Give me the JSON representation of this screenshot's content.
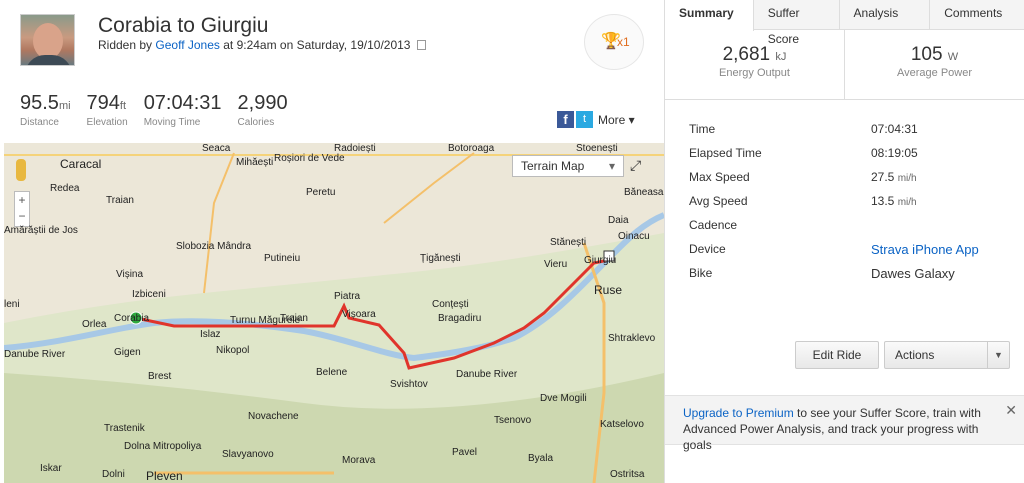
{
  "activity": {
    "title": "Corabia to Giurgiu",
    "ridden_by_prefix": "Ridden by",
    "athlete": "Geoff Jones",
    "time_text": "at 9:24am on Saturday, 19/10/2013",
    "achievement_count": "x1"
  },
  "stats": [
    {
      "value": "95.5",
      "unit": "mi",
      "label": "Distance"
    },
    {
      "value": "794",
      "unit": "ft",
      "label": "Elevation"
    },
    {
      "value": "07:04:31",
      "unit": "",
      "label": "Moving Time"
    },
    {
      "value": "2,990",
      "unit": "",
      "label": "Calories"
    }
  ],
  "share": {
    "facebook": "f",
    "twitter": "t",
    "more_label": "More ▾"
  },
  "map": {
    "type_label": "Terrain Map",
    "zoom_in": "+",
    "zoom_out": "−",
    "labels": [
      "Caracal",
      "Seaca",
      "Mihăești",
      "Roșiori de Vede",
      "Radoiești",
      "Botoroaga",
      "Stoenești",
      "Redea",
      "Traian",
      "Peretu",
      "Băneasa",
      "Amărăștii de Jos",
      "Slobozia Mândra",
      "Putineiu",
      "Daia",
      "Oinacu",
      "Stănești",
      "Vișina",
      "Țigănești",
      "Vieru",
      "Giurgiu",
      "Izbiceni",
      "Piatra",
      "Ruse",
      "Conțești",
      "leni",
      "Orlea",
      "Corabia",
      "Turnu Măgurele",
      "Traian",
      "Vișoara",
      "Bragadiru",
      "Danube River",
      "Islaz",
      "Nikopol",
      "Shtraklevo",
      "Gigen",
      "Brest",
      "Belene",
      "Svishtov",
      "Danube River",
      "Dve Mogili",
      "Novachene",
      "Trastenik",
      "Dolna Mitropoliya",
      "Slavyanovo",
      "Tsenovo",
      "Katselovo",
      "Pleven",
      "Pavel",
      "Byala",
      "Dolni",
      "Iskar",
      "Morava",
      "Ostritsa"
    ],
    "route_color": "#e0342b"
  },
  "tabs": [
    "Summary",
    "Suffer Score",
    "Analysis",
    "Comments"
  ],
  "metrics": [
    {
      "value": "2,681",
      "unit": "kJ",
      "label": "Energy Output"
    },
    {
      "value": "105",
      "unit": "W",
      "label": "Average Power"
    }
  ],
  "details": [
    {
      "key": "Time",
      "value": "07:04:31",
      "unit": ""
    },
    {
      "key": "Elapsed Time",
      "value": "08:19:05",
      "unit": ""
    },
    {
      "key": "Max Speed",
      "value": "27.5",
      "unit": "mi/h"
    },
    {
      "key": "Avg Speed",
      "value": "13.5",
      "unit": "mi/h"
    },
    {
      "key": "Cadence",
      "value": "",
      "unit": ""
    },
    {
      "key": "Device",
      "value": "Strava iPhone App",
      "unit": ""
    },
    {
      "key": "Bike",
      "value": "Dawes Galaxy",
      "unit": ""
    }
  ],
  "buttons": {
    "edit_ride": "Edit Ride",
    "actions": "Actions"
  },
  "promo": {
    "link": "Upgrade to Premium",
    "text": " to see your Suffer Score, train with Advanced Power Analysis, and track your progress with goals",
    "close": "✕"
  }
}
